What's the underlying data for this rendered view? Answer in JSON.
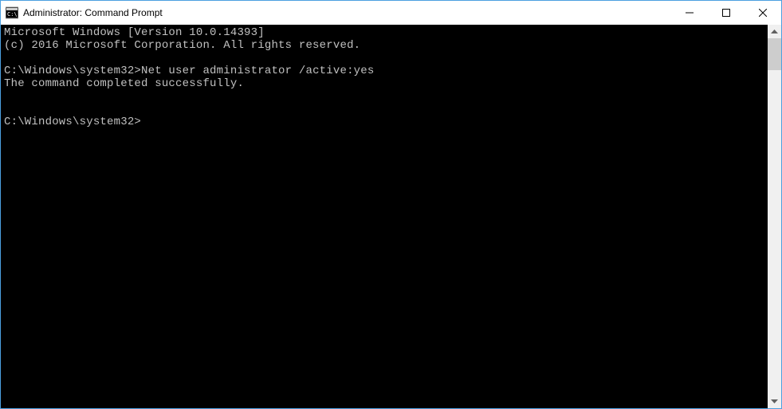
{
  "window": {
    "title": "Administrator: Command Prompt"
  },
  "console": {
    "header_line1": "Microsoft Windows [Version 10.0.14393]",
    "header_line2": "(c) 2016 Microsoft Corporation. All rights reserved.",
    "prompt1_path": "C:\\Windows\\system32>",
    "prompt1_cmd": "Net user administrator /active:yes",
    "output_line1": "The command completed successfully.",
    "prompt2_path": "C:\\Windows\\system32>"
  }
}
